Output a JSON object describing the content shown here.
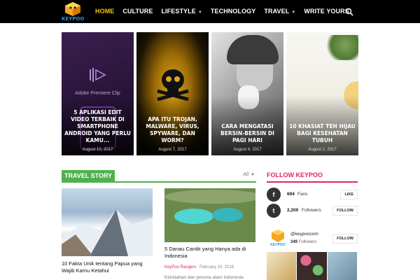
{
  "header": {
    "logo_text": "KEYPOO",
    "nav": [
      {
        "label": "HOME",
        "active": true,
        "has_dropdown": false
      },
      {
        "label": "CULTURE",
        "active": false,
        "has_dropdown": false
      },
      {
        "label": "LIFESTYLE",
        "active": false,
        "has_dropdown": true
      },
      {
        "label": "TECHNOLOGY",
        "active": false,
        "has_dropdown": false
      },
      {
        "label": "TRAVEL",
        "active": false,
        "has_dropdown": true
      },
      {
        "label": "WRITE YOURS",
        "active": false,
        "has_dropdown": false
      }
    ],
    "search_icon": "search-icon"
  },
  "featured": [
    {
      "title": "5 APLIKASI EDIT VIDEO TERBAIK DI SMARTPHONE ANDROID YANG PERLU KAMU...",
      "date": "August 10, 2017",
      "image_caption": "Adobe Premiere Clip"
    },
    {
      "title": "APA ITU TROJAN, MALWARE, VIRUS, SPYWARE, DAN WORM?",
      "date": "August 7, 2017"
    },
    {
      "title": "CARA MENGATASI BERSIN-BERSIN DI PAGI HARI",
      "date": "August 4, 2017"
    },
    {
      "title": "10 KHASIAT TEH HIJAU BAGI KESEHATAN TUBUH",
      "date": "August 2, 2017"
    }
  ],
  "travel": {
    "section_title": "TRAVEL STORY",
    "filter_label": "All",
    "posts": [
      {
        "title": "10 Fakta Unik tentang Papua yang Wajib Kamu Ketahui"
      },
      {
        "title": "5 Danau Cantik yang Hanya ada di Indonesia",
        "author": "KeyPoo Rangers",
        "date": "February 10, 2016",
        "excerpt": "Keindahan dan pesona alam Indonesia"
      }
    ]
  },
  "sidebar": {
    "title": "FOLLOW KEYPOO",
    "social": [
      {
        "icon": "facebook-icon",
        "glyph": "f",
        "count": "694",
        "label": "Fans",
        "button": "LIKE"
      },
      {
        "icon": "twitter-icon",
        "glyph": "t",
        "count": "2,200",
        "label": "Followers",
        "button": "FOLLOW"
      }
    ],
    "instagram": {
      "logo_text": "KEYPOO",
      "handle": "@keypoocom",
      "count": "349",
      "label": "Followers",
      "button": "FOLLOW"
    }
  },
  "colors": {
    "accent_nav": "#f5c518",
    "travel_green": "#4db24d",
    "follow_pink": "#e2246b",
    "logo_blue": "#2a8ee4"
  }
}
